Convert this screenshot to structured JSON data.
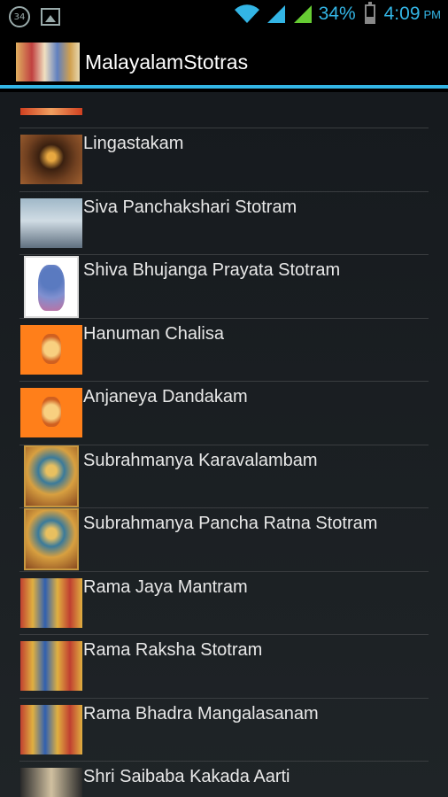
{
  "status_bar": {
    "notification_badge": "34",
    "battery_percent": "34%",
    "battery_level": 0.34,
    "time": "4:09",
    "ampm": "PM",
    "accent_color": "#33b5e5",
    "icons": [
      "notification-circle-icon",
      "gallery-icon",
      "wifi-icon",
      "signal-icon",
      "signal-icon",
      "battery-icon"
    ]
  },
  "action_bar": {
    "title": "MalayalamStotras",
    "icon": "app-icon"
  },
  "list": {
    "items": [
      {
        "label": "Lingastakam",
        "thumb": "t-ling"
      },
      {
        "label": "Siva Panchakshari Stotram",
        "thumb": "t-siva"
      },
      {
        "label": "Shiva Bhujanga Prayata Stotram",
        "thumb": "t-shiva"
      },
      {
        "label": "Hanuman Chalisa",
        "thumb": "t-han"
      },
      {
        "label": "Anjaneya Dandakam",
        "thumb": "t-han"
      },
      {
        "label": "Subrahmanya Karavalambam",
        "thumb": "t-subra"
      },
      {
        "label": "Subrahmanya Pancha Ratna Stotram",
        "thumb": "t-subra"
      },
      {
        "label": "Rama Jaya Mantram",
        "thumb": "t-rama"
      },
      {
        "label": "Rama Raksha Stotram",
        "thumb": "t-rama"
      },
      {
        "label": "Rama Bhadra Mangalasanam",
        "thumb": "t-rama"
      },
      {
        "label": "Shri Saibaba Kakada Aarti",
        "thumb": "t-sai"
      }
    ]
  }
}
